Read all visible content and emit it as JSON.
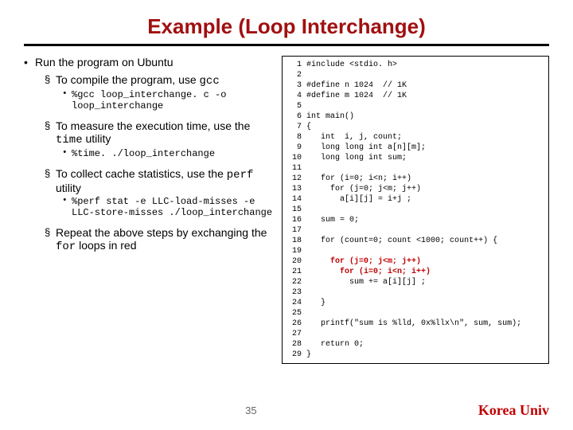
{
  "title": "Example (Loop Interchange)",
  "bullets": {
    "run": "Run the program on Ubuntu",
    "compile": "To compile the program, use ",
    "compile_cmd": "gcc",
    "compile_line": "%gcc  loop_interchange. c  -o loop_interchange",
    "measure": "To measure the execution time, use the ",
    "measure_util": "time",
    "measure_suffix": " utility",
    "measure_line": "%time. ./loop_interchange",
    "collect": "To collect cache statistics, use the ",
    "collect_util": "perf",
    "collect_suffix": " utility",
    "collect_line": "%perf  stat -e LLC-load-misses -e LLC-store-misses ./loop_interchange",
    "repeat_a": "Repeat the above steps by exchanging the ",
    "repeat_for": "for",
    "repeat_b": " loops in red"
  },
  "code": [
    "#include <stdio. h>",
    "",
    "#define n 1024  // 1K",
    "#define m 1024  // 1K",
    "",
    "int main()",
    "{",
    "   int  i, j, count;",
    "   long long int a[n][m];",
    "   long long int sum;",
    "",
    "   for (i=0; i<n; i++)",
    "     for (j=0; j<m; j++)",
    "       a[i][j] = i+j ;",
    "",
    "   sum = 0;",
    "",
    "   for (count=0; count <1000; count++) {",
    "",
    "     for (j=0; j<m; j++)",
    "       for (i=0; i<n; i++)",
    "         sum += a[i][j] ;",
    "",
    "   }",
    "",
    "   printf(\"sum is %lld, 0x%llx\\n\", sum, sum);",
    "",
    "   return 0;",
    "}"
  ],
  "red_lines": [
    20,
    21
  ],
  "page_number": "35",
  "university": "Korea Univ"
}
